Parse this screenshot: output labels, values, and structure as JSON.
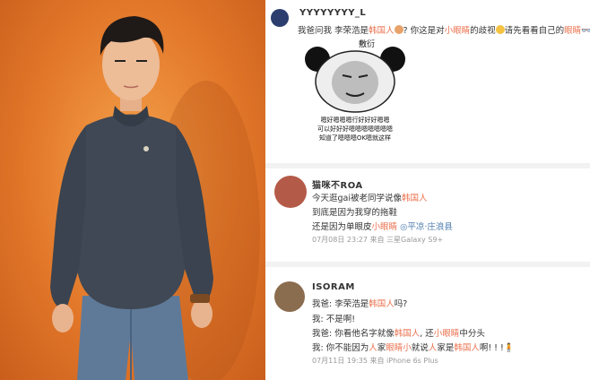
{
  "post1": {
    "username": "YYYYYYYY_L",
    "t1": "我爸问我 李荣浩是",
    "h1": "韩国人",
    "t2": "? 你这是对",
    "h2": "小眼睛",
    "t3": "的歧视",
    "t4": "请先看看自己的",
    "h3": "眼睛"
  },
  "meme": {
    "top_label": "敷衍",
    "line1": "嗯好嗯嗯嗯行好好好嗯嗯",
    "line2": "可以好好好嗯嗯嗯嗯嗯嗯嗯",
    "line3": "知道了嗯嗯嗯OK嗯就这样"
  },
  "post2": {
    "username": "猫咪不ROA",
    "l1a": "今天逛gai被老同学说像",
    "l1h": "韩国人",
    "l2": "到底是因为我穿的拖鞋",
    "l3a": "还是因为单眼皮",
    "l3h": "小眼睛",
    "location": "平凉·庄浪县",
    "meta": "07月08日 23:27  来自 三星Galaxy S9+"
  },
  "post3": {
    "username": "ISORAM",
    "l1a": "我爸: 李荣浩是",
    "l1h": "韩国人",
    "l1b": "吗?",
    "l2": "我: 不是啊!",
    "l3a": "我爸: 你看他名字就像",
    "l3h1": "韩国人",
    "l3b": ", 还",
    "l3h2": "小眼睛",
    "l3c": "中分头",
    "l4a": "我: 你不能因为",
    "l4h1": "人",
    "l4b": "家",
    "l4h2": "眼睛小",
    "l4c": "就说",
    "l4h3": "人",
    "l4d": "家是",
    "l4h4": "韩国人",
    "l4e": "啊! ! !",
    "meta": "07月11日 19:35  来自 iPhone 6s Plus"
  },
  "colors": {
    "highlight": "#eb7350",
    "meta": "#999999",
    "link": "#507daf",
    "photo_bg": "#e3782a"
  }
}
